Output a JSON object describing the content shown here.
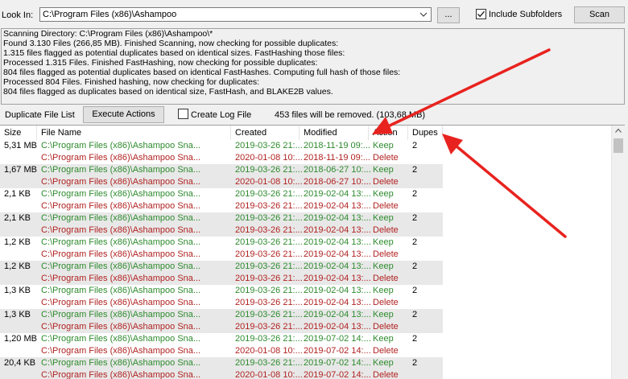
{
  "toolbar": {
    "look_in_label": "Look In:",
    "path": "C:\\Program Files (x86)\\Ashampoo",
    "browse_label": "...",
    "include_subfolders_label": "Include Subfolders",
    "include_subfolders_checked": true,
    "scan_label": "Scan"
  },
  "log": [
    "Scanning Directory: C:\\Program Files (x86)\\Ashampoo\\*",
    "Found 3.130 Files (266,85 MB). Finished Scanning, now checking for possible duplicates:",
    "1.315 files flagged as potential duplicates based on identical sizes. FastHashing those files:",
    "Processed 1.315 Files. Finished FastHashing, now checking for possible duplicates:",
    "804 files flagged as potential duplicates based on identical FastHashes. Computing full hash of those files:",
    "Processed 804 Files. Finished hashing, now checking for duplicates:",
    "804 files flagged as duplicates based on identical size, FastHash, and BLAKE2B values."
  ],
  "actions_bar": {
    "duplicate_list_label": "Duplicate File List",
    "execute_label": "Execute Actions",
    "create_log_label": "Create Log File",
    "create_log_checked": false,
    "removal_summary": "453 files will be removed. (103,68 MB)"
  },
  "table": {
    "headers": [
      "Size",
      "File Name",
      "Created",
      "Modified",
      "Action",
      "Dupes"
    ],
    "groups": [
      {
        "size": "5,31 MB",
        "dupes": "2",
        "files": [
          {
            "name": "C:\\Program Files (x86)\\Ashampoo Sna...",
            "created": "2019-03-26 21:...",
            "modified": "2018-11-19 09:...",
            "action": "Keep"
          },
          {
            "name": "C:\\Program Files (x86)\\Ashampoo Sna...",
            "created": "2020-01-08 10:...",
            "modified": "2018-11-19 09:...",
            "action": "Delete"
          }
        ]
      },
      {
        "size": "1,67 MB",
        "dupes": "2",
        "files": [
          {
            "name": "C:\\Program Files (x86)\\Ashampoo Sna...",
            "created": "2019-03-26 21:...",
            "modified": "2018-06-27 10:...",
            "action": "Keep"
          },
          {
            "name": "C:\\Program Files (x86)\\Ashampoo Sna...",
            "created": "2020-01-08 10:...",
            "modified": "2018-06-27 10:...",
            "action": "Delete"
          }
        ]
      },
      {
        "size": "2,1 KB",
        "dupes": "2",
        "files": [
          {
            "name": "C:\\Program Files (x86)\\Ashampoo Sna...",
            "created": "2019-03-26 21:...",
            "modified": "2019-02-04 13:...",
            "action": "Keep"
          },
          {
            "name": "C:\\Program Files (x86)\\Ashampoo Sna...",
            "created": "2019-03-26 21:...",
            "modified": "2019-02-04 13:...",
            "action": "Delete"
          }
        ]
      },
      {
        "size": "2,1 KB",
        "dupes": "2",
        "files": [
          {
            "name": "C:\\Program Files (x86)\\Ashampoo Sna...",
            "created": "2019-03-26 21:...",
            "modified": "2019-02-04 13:...",
            "action": "Keep"
          },
          {
            "name": "C:\\Program Files (x86)\\Ashampoo Sna...",
            "created": "2019-03-26 21:...",
            "modified": "2019-02-04 13:...",
            "action": "Delete"
          }
        ]
      },
      {
        "size": "1,2 KB",
        "dupes": "2",
        "files": [
          {
            "name": "C:\\Program Files (x86)\\Ashampoo Sna...",
            "created": "2019-03-26 21:...",
            "modified": "2019-02-04 13:...",
            "action": "Keep"
          },
          {
            "name": "C:\\Program Files (x86)\\Ashampoo Sna...",
            "created": "2019-03-26 21:...",
            "modified": "2019-02-04 13:...",
            "action": "Delete"
          }
        ]
      },
      {
        "size": "1,2 KB",
        "dupes": "2",
        "files": [
          {
            "name": "C:\\Program Files (x86)\\Ashampoo Sna...",
            "created": "2019-03-26 21:...",
            "modified": "2019-02-04 13:...",
            "action": "Keep"
          },
          {
            "name": "C:\\Program Files (x86)\\Ashampoo Sna...",
            "created": "2019-03-26 21:...",
            "modified": "2019-02-04 13:...",
            "action": "Delete"
          }
        ]
      },
      {
        "size": "1,3 KB",
        "dupes": "2",
        "files": [
          {
            "name": "C:\\Program Files (x86)\\Ashampoo Sna...",
            "created": "2019-03-26 21:...",
            "modified": "2019-02-04 13:...",
            "action": "Keep"
          },
          {
            "name": "C:\\Program Files (x86)\\Ashampoo Sna...",
            "created": "2019-03-26 21:...",
            "modified": "2019-02-04 13:...",
            "action": "Delete"
          }
        ]
      },
      {
        "size": "1,3 KB",
        "dupes": "2",
        "files": [
          {
            "name": "C:\\Program Files (x86)\\Ashampoo Sna...",
            "created": "2019-03-26 21:...",
            "modified": "2019-02-04 13:...",
            "action": "Keep"
          },
          {
            "name": "C:\\Program Files (x86)\\Ashampoo Sna...",
            "created": "2019-03-26 21:...",
            "modified": "2019-02-04 13:...",
            "action": "Delete"
          }
        ]
      },
      {
        "size": "1,20 MB",
        "dupes": "2",
        "files": [
          {
            "name": "C:\\Program Files (x86)\\Ashampoo Sna...",
            "created": "2019-03-26 21:...",
            "modified": "2019-07-02 14:...",
            "action": "Keep"
          },
          {
            "name": "C:\\Program Files (x86)\\Ashampoo Sna...",
            "created": "2020-01-08 10:...",
            "modified": "2019-07-02 14:...",
            "action": "Delete"
          }
        ]
      },
      {
        "size": "20,4 KB",
        "dupes": "2",
        "files": [
          {
            "name": "C:\\Program Files (x86)\\Ashampoo Sna...",
            "created": "2019-03-26 21:...",
            "modified": "2019-07-02 14:...",
            "action": "Keep"
          },
          {
            "name": "C:\\Program Files (x86)\\Ashampoo Sna...",
            "created": "2020-01-08 10:...",
            "modified": "2019-07-02 14:...",
            "action": "Delete"
          }
        ]
      }
    ]
  },
  "colors": {
    "keep": "#2e8b2e",
    "delete": "#b22222",
    "annotation_arrow": "#e8231f",
    "group_shade": "#e8e8e8"
  }
}
